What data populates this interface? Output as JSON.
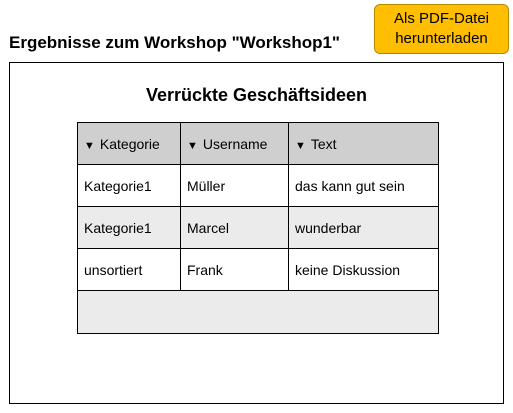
{
  "page": {
    "title": "Ergebnisse zum Workshop \"Workshop1\""
  },
  "pdf_button": {
    "line1": "Als PDF-Datei",
    "line2": "herunterladen",
    "color": "#ffbf00"
  },
  "panel": {
    "title": "Verrückte Geschäftsideen"
  },
  "table": {
    "columns": [
      {
        "label": "Kategorie",
        "icon": "sort-down-icon"
      },
      {
        "label": "Username",
        "icon": "sort-down-icon"
      },
      {
        "label": "Text",
        "icon": "sort-down-icon"
      }
    ],
    "rows": [
      {
        "kategorie": "Kategorie1",
        "username": "Müller",
        "text": "das kann gut sein"
      },
      {
        "kategorie": "Kategorie1",
        "username": "Marcel",
        "text": "wunderbar"
      },
      {
        "kategorie": "unsortiert",
        "username": "Frank",
        "text": "keine Diskussion"
      }
    ],
    "header_color": "#cfcfcf",
    "alt_row_color": "#ebebeb"
  }
}
